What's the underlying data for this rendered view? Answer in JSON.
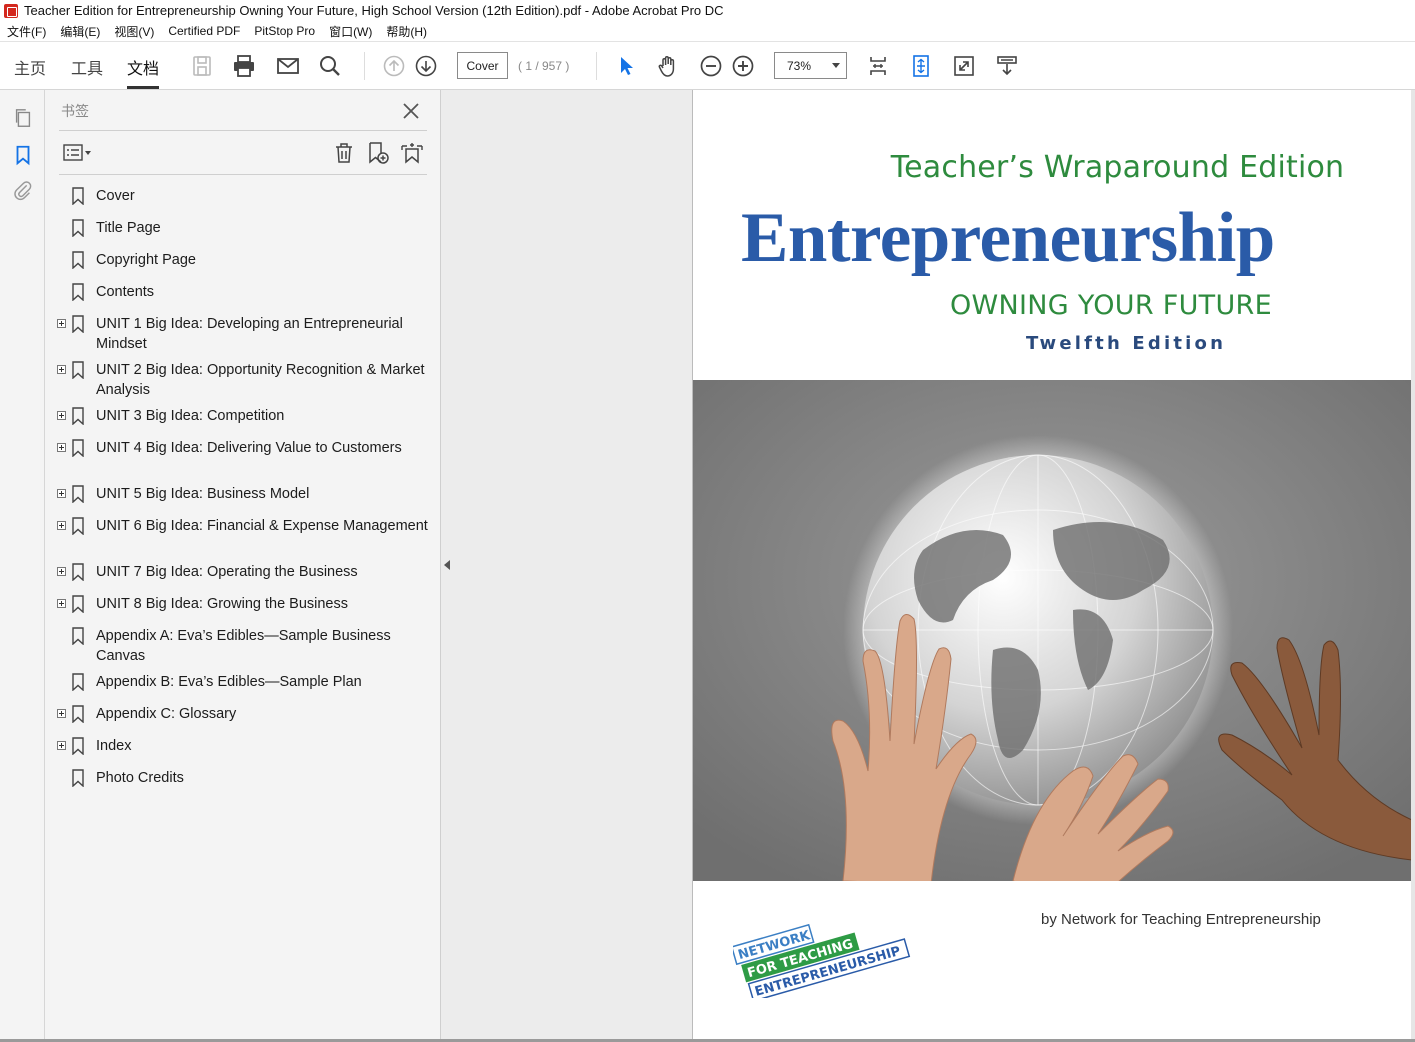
{
  "window": {
    "title": "Teacher Edition for Entrepreneurship Owning Your Future, High School Version (12th Edition).pdf - Adobe Acrobat Pro DC"
  },
  "menu": [
    "文件(F)",
    "编辑(E)",
    "视图(V)",
    "Certified PDF",
    "PitStop Pro",
    "窗口(W)",
    "帮助(H)"
  ],
  "toolbar": {
    "tabs": [
      "主页",
      "工具",
      "文档"
    ],
    "active_tab": "文档",
    "page_field": "Cover",
    "page_count": "( 1 / 957 )",
    "zoom": "73%"
  },
  "panel": {
    "title": "书签",
    "bookmarks": [
      {
        "label": "Cover",
        "expandable": false
      },
      {
        "label": "Title Page",
        "expandable": false
      },
      {
        "label": "Copyright Page",
        "expandable": false
      },
      {
        "label": "Contents",
        "expandable": false
      },
      {
        "label": "UNIT 1 Big Idea: Developing an Entrepreneurial Mindset",
        "expandable": true
      },
      {
        "label": "UNIT 2 Big Idea: Opportunity Recognition & Market Analysis",
        "expandable": true
      },
      {
        "label": "UNIT 3 Big Idea: Competition",
        "expandable": true
      },
      {
        "label": "UNIT 4 Big Idea: Delivering Value to Customers",
        "expandable": true
      },
      {
        "label": "UNIT 5 Big Idea: Business Model",
        "expandable": true
      },
      {
        "label": "UNIT 6 Big Idea: Financial & Expense Management",
        "expandable": true
      },
      {
        "label": "UNIT 7 Big Idea: Operating the Business",
        "expandable": true
      },
      {
        "label": "UNIT 8 Big Idea: Growing the Business",
        "expandable": true
      },
      {
        "label": "Appendix A: Eva’s Edibles—Sample Business Canvas",
        "expandable": false
      },
      {
        "label": "Appendix B: Eva’s Edibles—Sample Plan",
        "expandable": false
      },
      {
        "label": "Appendix C: Glossary",
        "expandable": true
      },
      {
        "label": "Index",
        "expandable": true
      },
      {
        "label": "Photo Credits",
        "expandable": false
      }
    ]
  },
  "cover": {
    "edition_line": "Teacher’s Wraparound Edition",
    "title": "Entrepreneurship",
    "subtitle": "OWNING YOUR FUTURE",
    "edition": "Twelfth Edition",
    "byline": "by Network for Teaching Entrepreneurship",
    "logo_lines": [
      "NETWORK",
      "FOR TEACHING",
      "ENTREPRENEURSHIP"
    ]
  },
  "colors": {
    "accent_blue": "#2a5ba8",
    "accent_green": "#2e8b3e",
    "acrobat_blue": "#1473e6"
  }
}
